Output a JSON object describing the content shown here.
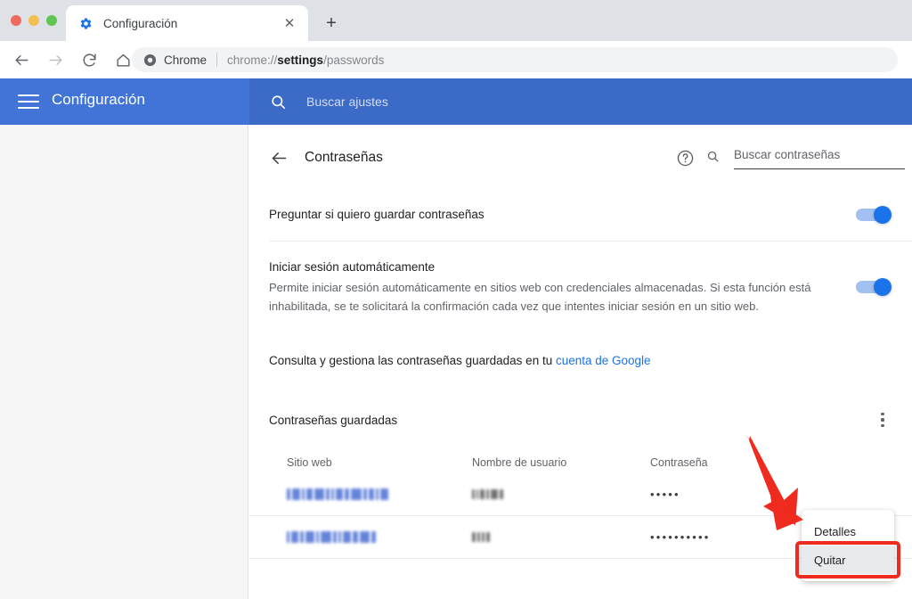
{
  "browser": {
    "window_controls": [
      "close",
      "minimize",
      "maximize"
    ],
    "tab": {
      "title": "Configuración",
      "favicon": "gear-icon",
      "close_label": "✕"
    },
    "new_tab_label": "+",
    "nav": {
      "back": "←",
      "forward": "→",
      "reload": "⟳",
      "home": "⌂"
    },
    "omnibox": {
      "chrome_label": "Chrome",
      "url_prefix": "chrome://",
      "url_bold": "settings",
      "url_suffix": "/passwords",
      "icon": "chrome-logo-icon"
    }
  },
  "settings_header": {
    "menu_icon": "hamburger-icon",
    "title": "Configuración",
    "search": {
      "icon": "search-icon",
      "placeholder": "Buscar ajustes"
    }
  },
  "page": {
    "back_icon": "back-arrow-icon",
    "title": "Contraseñas",
    "help_icon": "help-circle-icon",
    "search": {
      "icon": "search-icon",
      "placeholder": "Buscar contraseñas",
      "value": ""
    }
  },
  "settings_rows": [
    {
      "label": "Preguntar si quiero guardar contraseñas",
      "sub": "",
      "toggle_on": true
    },
    {
      "label": "Iniciar sesión automáticamente",
      "sub": "Permite iniciar sesión automáticamente en sitios web con credenciales almacenadas. Si esta función está inhabilitada, se te solicitará la confirmación cada vez que intentes iniciar sesión en un sitio web.",
      "toggle_on": true
    }
  ],
  "account_note": {
    "text": "Consulta y gestiona las contraseñas guardadas en tu ",
    "link": "cuenta de Google"
  },
  "saved_section": {
    "title": "Contraseñas guardadas",
    "kebab_icon": "more-vertical-icon"
  },
  "table": {
    "columns": [
      "Sitio web",
      "Nombre de usuario",
      "Contraseña"
    ],
    "rows": [
      {
        "site": "",
        "username": "",
        "password": "•••••"
      },
      {
        "site": "",
        "username": "",
        "password": "••••••••••"
      }
    ]
  },
  "context_menu": {
    "items": [
      {
        "label": "Detalles",
        "active": false
      },
      {
        "label": "Quitar",
        "active": true
      }
    ]
  },
  "annotation": {
    "arrow_color": "#ee2b1e",
    "highlight_color": "#ee2b1e",
    "highlight_target": "Quitar"
  },
  "colors": {
    "header_blue": "#4274d8",
    "header_search_blue": "#3b6ac7",
    "link_blue": "#1a73e8",
    "toggle_blue": "#1a73e8",
    "toggle_track": "#a2c0f2",
    "annotation_red": "#ee2b1e"
  }
}
